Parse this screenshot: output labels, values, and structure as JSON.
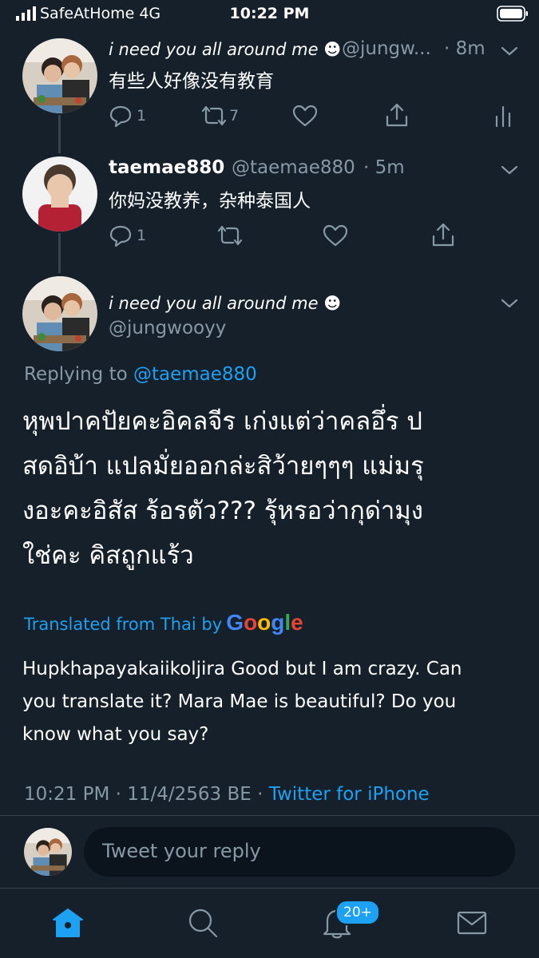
{
  "status_bar": {
    "carrier": "SafeAtHome  4G",
    "time": "10:22 PM"
  },
  "tweet1": {
    "name": "i need you all around me",
    "handle": "@jungw...",
    "time": "· 8m",
    "text": "有些人好像没有教育",
    "replies": "1",
    "retweets": "7"
  },
  "tweet2": {
    "name": "taemae880",
    "handle": "@taemae880",
    "time": "· 5m",
    "text": "你妈没教养，杂种泰国人",
    "replies": "1"
  },
  "main_tweet": {
    "name": "i need you all around me",
    "handle": "@jungwooyy",
    "replying_prefix": "Replying to",
    "replying_to": "@taemae880",
    "thai_lines": [
      "หุพปาคปัยคะอิคลจีร เก่งแต่ว่าคลอึ่ร ป",
      "สดอิบ้า แปลมั่ยออกล่ะสิว้ายๆๆๆ แม่มรุ",
      "งอะคะอิสัส ร้อรตัว??? รุ้หรอว่ากุด่ามุง",
      " ใช่คะ คิสถูกแร้ว"
    ],
    "translated_from": "Translated from Thai by",
    "translator": "Google",
    "translation_lines": [
      "Hupkhapayakaiikoljira Good but I am crazy. Can",
      "you translate it? Mara Mae is beautiful? Do you",
      "know what you say?"
    ],
    "timestamp": "10:21 PM · 11/4/2563 BE · ",
    "source": "Twitter for iPhone"
  },
  "reply": {
    "placeholder": "Tweet your reply"
  },
  "tabbar": {
    "notifications_badge": "20+"
  },
  "colors": {
    "background": "#15202b",
    "accent": "#1da1f2",
    "secondary_text": "#8899a6",
    "divider": "#38444d"
  },
  "icons": [
    "home-icon",
    "search-icon",
    "bell-icon",
    "mail-icon",
    "reply-icon",
    "retweet-icon",
    "like-icon",
    "share-icon",
    "analytics-icon",
    "chevron-down-icon"
  ]
}
